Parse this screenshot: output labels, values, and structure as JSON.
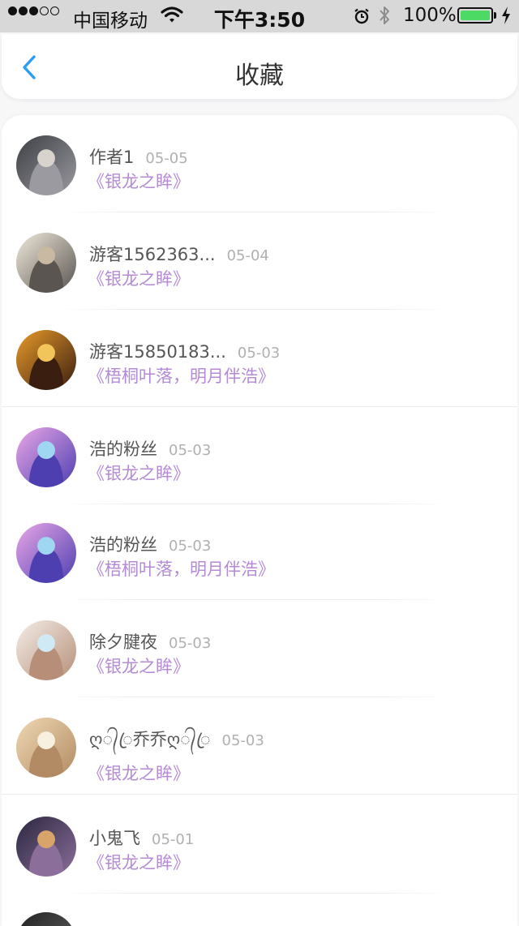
{
  "status_bar": {
    "carrier": "中国移动",
    "time": "下午3:50",
    "battery": "100%",
    "signal_bars_filled": 3,
    "signal_bars_total": 5,
    "battery_level": 1.0
  },
  "nav": {
    "title": "收藏",
    "back_icon": "chevron-left-icon"
  },
  "colors": {
    "accent_blue": "#2a9df4",
    "book_title_purple": "#b48ad6",
    "battery_green": "#4cd964"
  },
  "favorites": [
    {
      "name": "作者1",
      "date": "05-05",
      "book": "《银龙之眸》",
      "avatar_colors": [
        "#3d3f45",
        "#9a9aa0",
        "#d8d3cc"
      ]
    },
    {
      "name": "游客1562363...",
      "date": "05-04",
      "book": "《银龙之眸》",
      "avatar_colors": [
        "#efe9dc",
        "#5a5550",
        "#c9b9a3"
      ]
    },
    {
      "name": "游客15850183...",
      "date": "05-03",
      "book": "《梧桐叶落，明月伴浩》",
      "avatar_colors": [
        "#e89a2a",
        "#3a1f10",
        "#f2c55a"
      ]
    },
    {
      "name": "浩的粉丝",
      "date": "05-03",
      "book": "《银龙之眸》",
      "avatar_colors": [
        "#e9a7e8",
        "#4e3fb0",
        "#9fd7f2"
      ]
    },
    {
      "name": "浩的粉丝",
      "date": "05-03",
      "book": "《梧桐叶落，明月伴浩》",
      "avatar_colors": [
        "#e9a7e8",
        "#4e3fb0",
        "#9fd7f2"
      ]
    },
    {
      "name": "除夕腱夜",
      "date": "05-03",
      "book": "《银龙之眸》",
      "avatar_colors": [
        "#f3ede8",
        "#b78f78",
        "#cfe9f5"
      ]
    },
    {
      "name": "ღ᭄ꦿ乔乔ღ᭄ꦿ",
      "date": "05-03",
      "book": "《银龙之眸》",
      "avatar_colors": [
        "#efd9b3",
        "#b28a63",
        "#f7efe0"
      ]
    },
    {
      "name": "小鬼飞",
      "date": "05-01",
      "book": "《银龙之眸》",
      "avatar_colors": [
        "#2b2740",
        "#8b6f9a",
        "#d8a46a"
      ]
    }
  ]
}
